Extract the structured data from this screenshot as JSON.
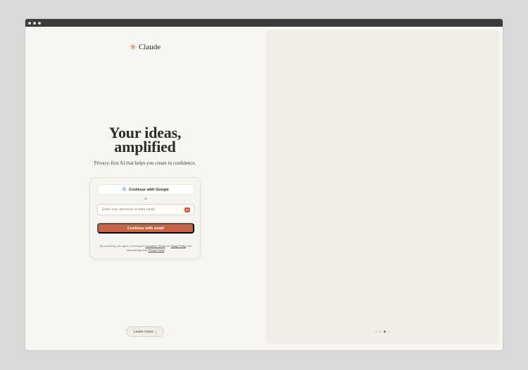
{
  "brand": {
    "name": "Claude",
    "mark": "✳"
  },
  "headline": {
    "line1": "Your ideas,",
    "line2": "amplified"
  },
  "subheadline": "Privacy-first AI that helps you create in confidence.",
  "google_button": {
    "icon": "G",
    "label": "Continue with Google"
  },
  "divider": "or",
  "email": {
    "placeholder": "Enter your personal or work email",
    "badge_icon": "password-manager-icon"
  },
  "continue_button": {
    "label": "Continue with email"
  },
  "terms": {
    "prefix": "By continuing, you agree to Anthropic's ",
    "consumer_terms": "Consumer Terms",
    "and": " and ",
    "usage_policy": "Usage Policy",
    "middle": ", and acknowledge their ",
    "privacy_policy": "Privacy Policy",
    "suffix": "."
  },
  "learn_more": {
    "label": "Learn more",
    "arrow": "↓"
  },
  "carousel": {
    "count": 4,
    "active_index": 2
  },
  "colors": {
    "accent": "#c96442",
    "brand_mark": "#d9643a"
  }
}
